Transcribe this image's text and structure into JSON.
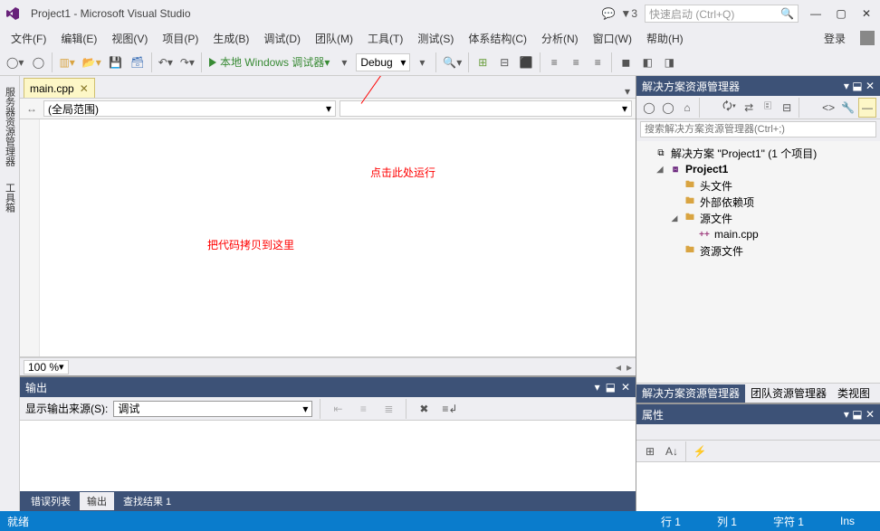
{
  "titlebar": {
    "title": "Project1 - Microsoft Visual Studio",
    "notify_count": "3",
    "quicklaunch_placeholder": "快速启动 (Ctrl+Q)"
  },
  "menubar": {
    "items": [
      "文件(F)",
      "编辑(E)",
      "视图(V)",
      "项目(P)",
      "生成(B)",
      "调试(D)",
      "团队(M)",
      "工具(T)",
      "测试(S)",
      "体系结构(C)",
      "分析(N)",
      "窗口(W)",
      "帮助(H)"
    ],
    "login": "登录"
  },
  "toolbar": {
    "debug_button": "本地 Windows 调试器",
    "config": "Debug"
  },
  "left_tabs": [
    "服务器资源管理器",
    "工具箱"
  ],
  "doc_tab": {
    "label": "main.cpp"
  },
  "editor": {
    "scope": "(全局范围)",
    "zoom": "100 %",
    "annotation_run": "点击此处运行",
    "annotation_paste": "把代码拷贝到这里"
  },
  "output": {
    "title": "输出",
    "source_label": "显示输出来源(S):",
    "source_value": "调试"
  },
  "bottom_tabs": [
    "错误列表",
    "输出",
    "查找结果 1"
  ],
  "solution": {
    "title": "解决方案资源管理器",
    "search_placeholder": "搜索解决方案资源管理器(Ctrl+;)",
    "root": "解决方案 \"Project1\" (1 个项目)",
    "project": "Project1",
    "folders": {
      "headers": "头文件",
      "external": "外部依赖项",
      "sources": "源文件",
      "resources": "资源文件"
    },
    "file": "main.cpp"
  },
  "right_tabs": [
    "解决方案资源管理器",
    "团队资源管理器",
    "类视图"
  ],
  "props": {
    "title": "属性"
  },
  "statusbar": {
    "ready": "就绪",
    "line_label": "行 1",
    "col_label": "列 1",
    "char_label": "字符 1",
    "ins": "Ins"
  }
}
